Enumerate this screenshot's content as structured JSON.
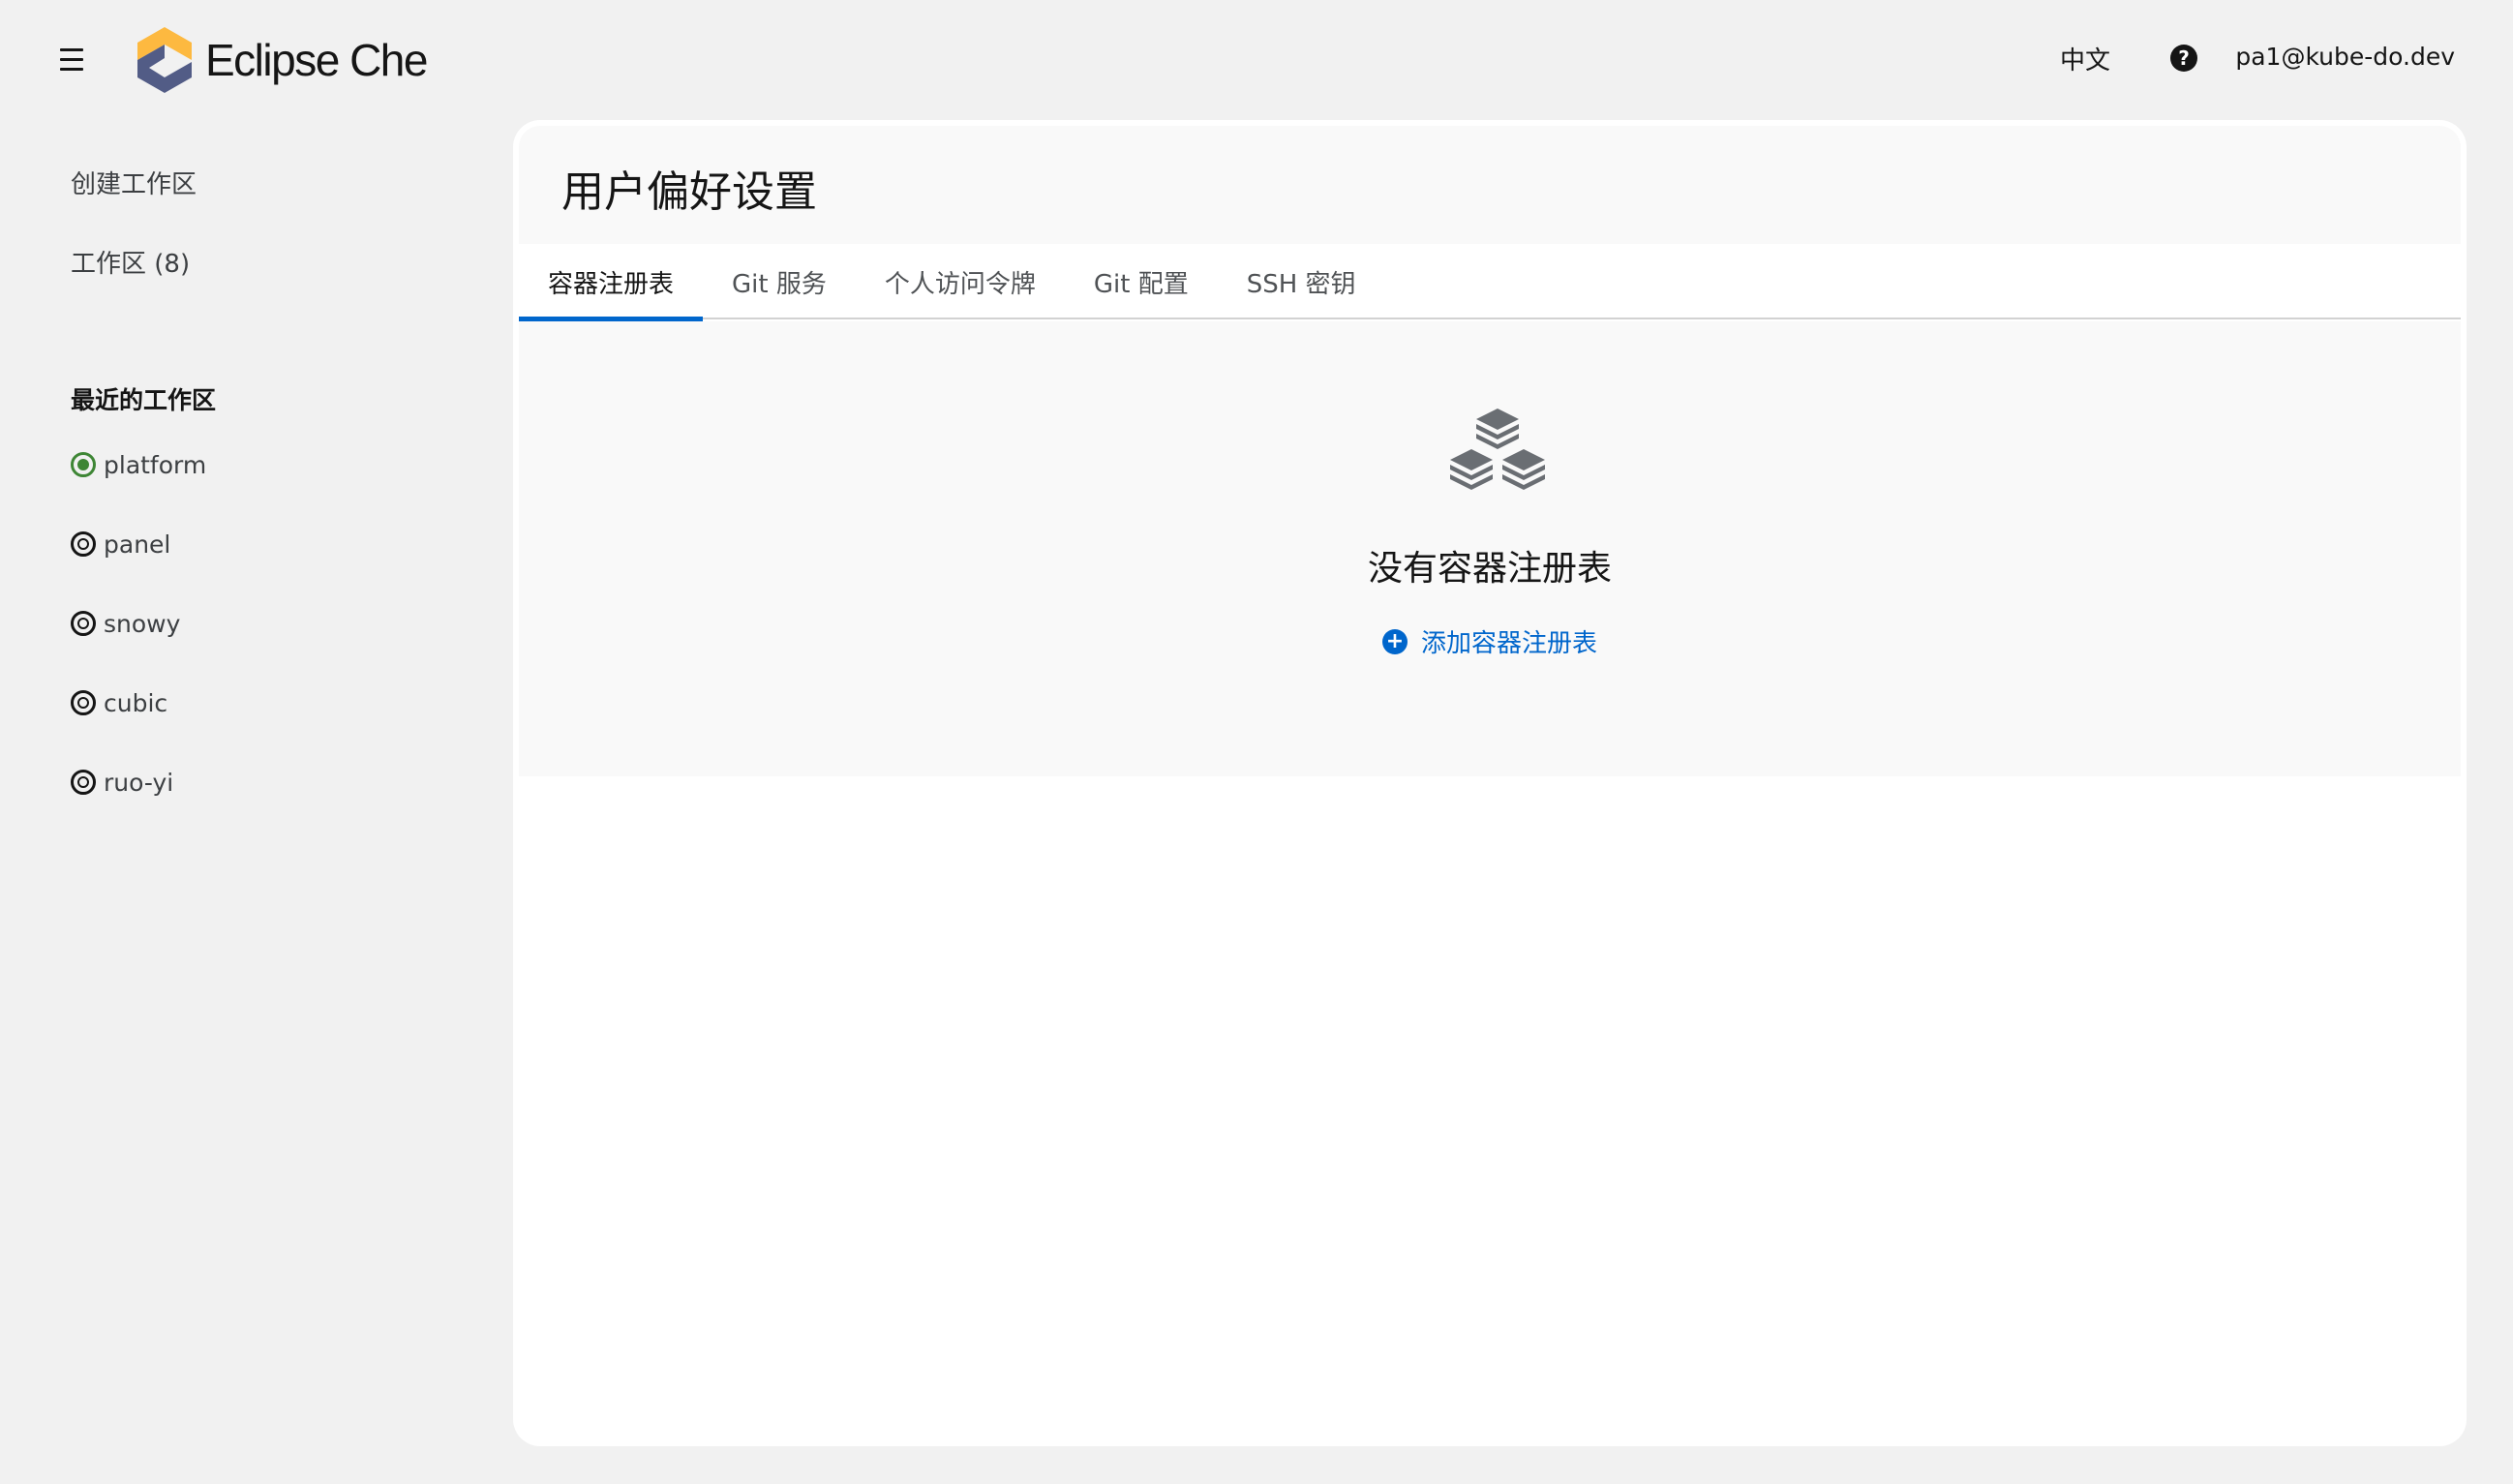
{
  "header": {
    "brand_name": "Eclipse Che",
    "language": "中文",
    "help_icon": "question-circle-icon",
    "user": "pa1@kube-do.dev"
  },
  "sidebar": {
    "create_workspace": "创建工作区",
    "workspaces": "工作区 (8)",
    "recent_title": "最近的工作区",
    "recent": [
      {
        "name": "platform",
        "status": "running"
      },
      {
        "name": "panel",
        "status": "stopped"
      },
      {
        "name": "snowy",
        "status": "stopped"
      },
      {
        "name": "cubic",
        "status": "stopped"
      },
      {
        "name": "ruo-yi",
        "status": "stopped"
      }
    ]
  },
  "main": {
    "title": "用户偏好设置",
    "tabs": [
      {
        "label": "容器注册表",
        "active": true
      },
      {
        "label": "Git 服务",
        "active": false
      },
      {
        "label": "个人访问令牌",
        "active": false
      },
      {
        "label": "Git 配置",
        "active": false
      },
      {
        "label": "SSH 密钥",
        "active": false
      }
    ],
    "empty_state": {
      "icon": "cubes-icon",
      "title": "没有容器注册表",
      "action": "添加容器注册表"
    }
  },
  "colors": {
    "accent": "#0066cc",
    "running": "#3e8635",
    "background": "#f1f1f1"
  }
}
